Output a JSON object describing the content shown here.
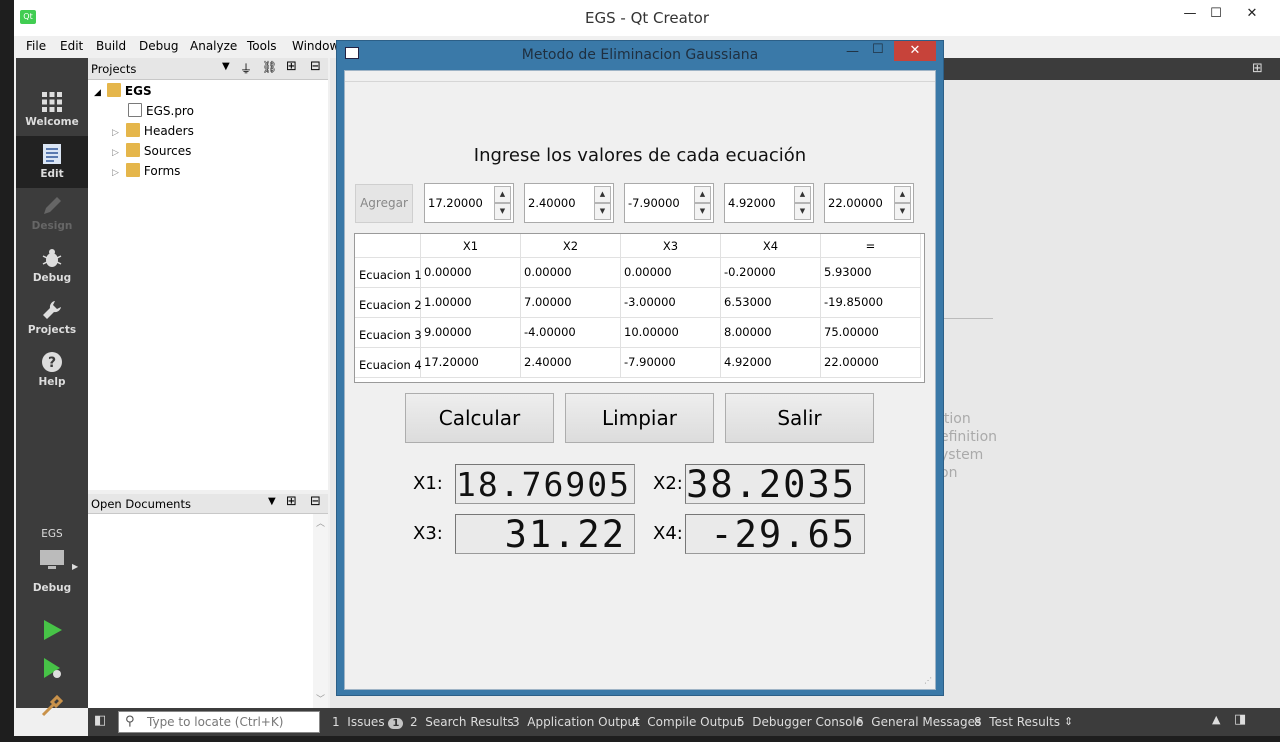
{
  "window": {
    "title": "EGS - Qt Creator",
    "min": "—",
    "max": "☐",
    "close": "✕"
  },
  "menu": [
    "File",
    "Edit",
    "Build",
    "Debug",
    "Analyze",
    "Tools",
    "Window"
  ],
  "modes": [
    {
      "label": "Welcome",
      "icon": "grid-icon"
    },
    {
      "label": "Edit",
      "icon": "document-icon"
    },
    {
      "label": "Design",
      "icon": "pencil-icon"
    },
    {
      "label": "Debug",
      "icon": "bug-icon"
    },
    {
      "label": "Projects",
      "icon": "wrench-icon"
    },
    {
      "label": "Help",
      "icon": "help-icon"
    }
  ],
  "kit": {
    "project": "EGS",
    "config": "Debug"
  },
  "projects_pane": {
    "title": "Projects",
    "tree": {
      "root": "EGS",
      "children": [
        "EGS.pro",
        "Headers",
        "Sources",
        "Forms"
      ]
    }
  },
  "open_documents": {
    "title": "Open Documents"
  },
  "locator": {
    "placeholder": "Type to locate (Ctrl+K)"
  },
  "output_tabs": [
    {
      "num": "1",
      "label": "Issues",
      "badge": "1"
    },
    {
      "num": "2",
      "label": "Search Results"
    },
    {
      "num": "3",
      "label": "Application Output"
    },
    {
      "num": "4",
      "label": "Compile Output"
    },
    {
      "num": "5",
      "label": "Debugger Console"
    },
    {
      "num": "6",
      "label": "General Messages"
    },
    {
      "num": "8",
      "label": "Test Results"
    }
  ],
  "background_fragments": [
    "ition",
    "efinition",
    "ystem",
    "on"
  ],
  "dialog": {
    "title": "Metodo de Eliminacion Gaussiana",
    "close": "✕",
    "heading": "Ingrese los valores de cada ecuación",
    "add_button": "Agregar",
    "inputs": [
      "17.20000",
      "2.40000",
      "-7.90000",
      "4.92000",
      "22.00000"
    ],
    "table": {
      "columns": [
        "X1",
        "X2",
        "X3",
        "X4",
        "="
      ],
      "rows": [
        {
          "label": "Ecuacion 1",
          "cells": [
            "0.00000",
            "0.00000",
            "0.00000",
            "-0.20000",
            "5.93000"
          ]
        },
        {
          "label": "Ecuacion 2",
          "cells": [
            "1.00000",
            "7.00000",
            "-3.00000",
            "6.53000",
            "-19.85000"
          ]
        },
        {
          "label": "Ecuacion 3",
          "cells": [
            "9.00000",
            "-4.00000",
            "10.00000",
            "8.00000",
            "75.00000"
          ]
        },
        {
          "label": "Ecuacion 4",
          "cells": [
            "17.20000",
            "2.40000",
            "-7.90000",
            "4.92000",
            "22.00000"
          ]
        }
      ]
    },
    "buttons": {
      "calculate": "Calcular",
      "clear": "Limpiar",
      "exit": "Salir"
    },
    "results": [
      {
        "label": "X1:",
        "value": "18.76905"
      },
      {
        "label": "X2:",
        "value": "38.2035"
      },
      {
        "label": "X3:",
        "value": "31.22"
      },
      {
        "label": "X4:",
        "value": "-29.65"
      }
    ]
  }
}
